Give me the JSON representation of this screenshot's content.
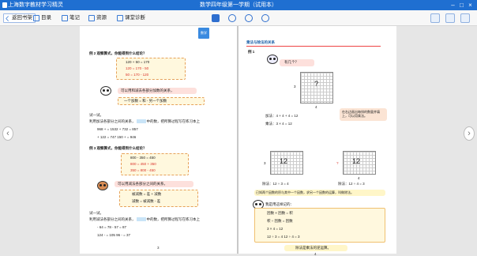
{
  "window": {
    "app_title": "上海数字教材学习精灵",
    "book_title": "数学四年级第一学期（试用本）",
    "controls": [
      "–",
      "□",
      "×"
    ]
  },
  "toolbar": {
    "back": "返回书架",
    "catalog": "目录",
    "notes": "笔记",
    "resources": "资源",
    "class": "课堂诊断",
    "icons": [
      "grid-view-icon",
      "eye-icon",
      "zoom-in-icon",
      "zoom-out-icon"
    ],
    "right_icons": [
      "pen-icon",
      "image-icon",
      "link-icon"
    ]
  },
  "left_page": {
    "tab": "数学",
    "ex2_title": "例 2  观察算式，你能得到什么结论？",
    "ex2_lines": [
      "120  +  50  =  170",
      "120  =  170  -  50",
      "50  =  170  -  120"
    ],
    "ex2_bubble": "可以用和减去各部分加数的关系，",
    "ex2_formula": "一个加数  =  和  -  另一个加数",
    "try1": "试一试。",
    "try1_desc": "利用加法各部分之间的关系，",
    "try1_desc2": "中的数，把所算过程写在练习本上",
    "try1_rows": [
      "968  +        =  1532          +  732  =  857",
      "+  122  =  747         150  +        =  946"
    ],
    "ex3_title": "例 3  观察算式，你能得到什么结论？",
    "ex3_lines": [
      "800  -  350  =  450",
      "800  =  450  +  350",
      "350  =  800  -  450"
    ],
    "ex3_bubble": "可以用减法各部分之间的关系，",
    "ex3_formula1": "被减数  =  差  +  减数",
    "ex3_formula2": "减数  =  被减数  -  差",
    "try2": "试一试。",
    "try2_desc": "利用减法各部分之间的关系，",
    "try2_desc2": "中的数，把所算过程写在练习本上",
    "try2_rows": [
      "-  64  =  78           -  57  =  87",
      "124  -        =  105          96  -        =  37"
    ],
    "page_no": "3"
  },
  "right_page": {
    "heading": "乘法与除法的关系",
    "ex1": "例 1",
    "bubble_q": "有几个？",
    "g1_q": "?",
    "g1_left": "3",
    "g1_bottom": "4",
    "eq1": "加法：4 + 4 + 4 = 12",
    "eq2": "乘法：3 × 4 = 12",
    "bubble_mid": "在右边画出每排的数量并填上，可以用乘法。",
    "g2_val": "12",
    "g2_left": "3",
    "g3_val": "12",
    "g3_q": "?",
    "g3_bottom": "4",
    "div1": "除法：12 ÷ 3 = 4",
    "div2": "除法：12 ÷ 4 = 3",
    "bubble_low": "已知两个因数的积与其中一个因数，求另一个因数的运算，叫做除法。",
    "tip": "我是用这样记的：",
    "rel1": "因数  ×  因数  =  积",
    "rel2": "积  ÷  因数  =  因数",
    "rel3": "3   ×   4   =   12",
    "rel4": "12  ÷  3  =  4     12 ÷ 4 = 3",
    "footer_note": "除法是乘法的逆运算。",
    "page_no": "4"
  }
}
